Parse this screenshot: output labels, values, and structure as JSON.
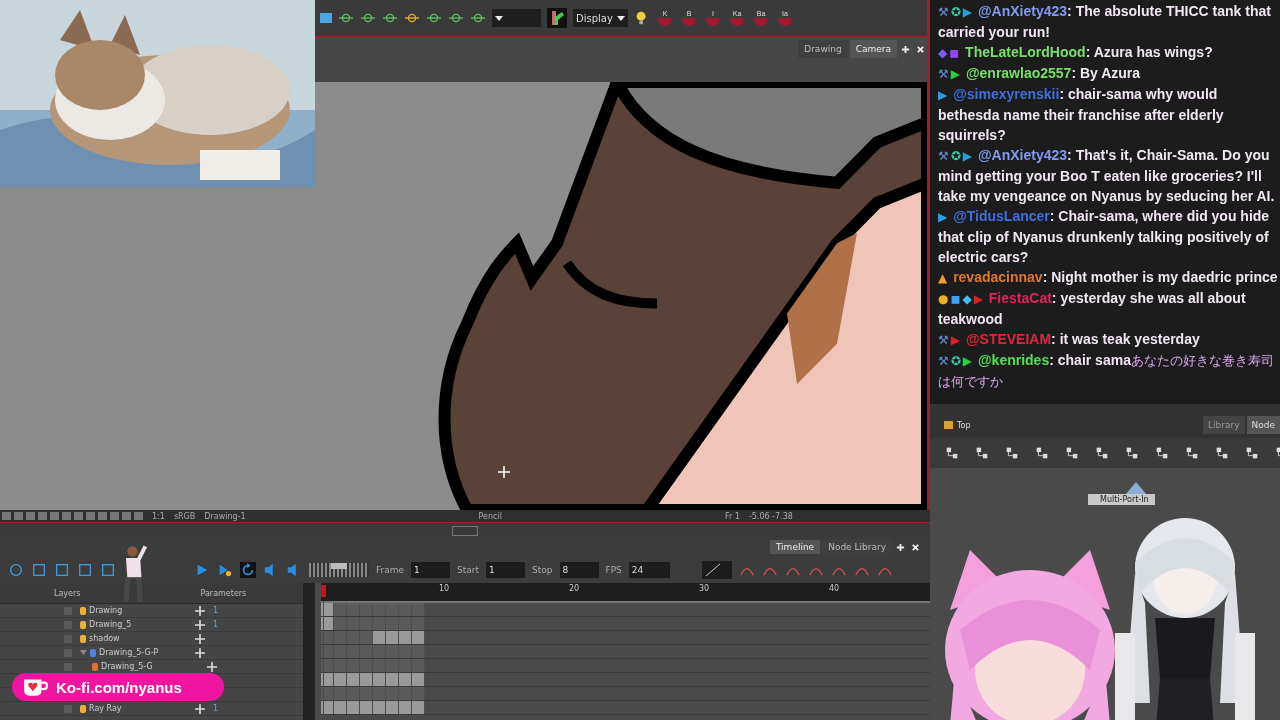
{
  "toolbar": {
    "display_select": "Display",
    "key_buttons": [
      "K",
      "B",
      "I",
      "Ka",
      "Ba",
      "Ia"
    ]
  },
  "view_tabs": [
    {
      "label": "Drawing",
      "selected": false
    },
    {
      "label": "Camera",
      "selected": true
    }
  ],
  "status_bar": {
    "zoom": "1:1",
    "color_space": "sRGB",
    "drawing": "Drawing-1",
    "tool": "Pencil",
    "frame": "Fr 1",
    "coordinates": "-5.06 -7.38"
  },
  "timeline_toolbar": {
    "frame_label": "Frame",
    "frame": "1",
    "start_label": "Start",
    "start": "1",
    "stop_label": "Stop",
    "stop": "8",
    "fps_label": "FPS",
    "fps": "24"
  },
  "playback_speed": {
    "level": 0.5
  },
  "timeline_tabs": [
    {
      "label": "Timeline",
      "selected": true
    },
    {
      "label": "Node Library",
      "selected": false
    }
  ],
  "layers_panel": {
    "layers_header": "Layers",
    "parameters_header": "Parameters",
    "layers": [
      {
        "name": "Drawing",
        "kind": "drawing",
        "param": "1",
        "frames": [
          true,
          false,
          false,
          false,
          false,
          false,
          false,
          false
        ]
      },
      {
        "name": "Drawing_5",
        "kind": "drawing",
        "param": "1",
        "frames": [
          true,
          false,
          false,
          false,
          false,
          false,
          false,
          false
        ]
      },
      {
        "name": "shadow",
        "kind": "drawing",
        "frames": [
          false,
          false,
          false,
          false,
          true,
          true,
          true,
          true
        ]
      },
      {
        "name": "Drawing_5-G-P",
        "kind": "group",
        "expanded": true,
        "frames": [
          false,
          false,
          false,
          false,
          false,
          false,
          false,
          false
        ],
        "children": [
          {
            "name": "Drawing_5-G",
            "kind": "composite",
            "frames": [
              false,
              false,
              false,
              false,
              false,
              false,
              false,
              false
            ]
          }
        ]
      },
      {
        "kind": "drawing",
        "frames": [
          true,
          true,
          true,
          true,
          true,
          true,
          true,
          true
        ]
      },
      {
        "kind": "drawing",
        "frames": [
          false,
          false,
          false,
          false,
          false,
          false,
          false,
          false
        ]
      },
      {
        "name": "Ray Ray",
        "kind": "drawing",
        "param": "1",
        "frames": [
          true,
          true,
          true,
          true,
          true,
          true,
          true,
          true
        ]
      }
    ]
  },
  "ruler": [
    "10",
    "20",
    "30",
    "40"
  ],
  "kofi_badge": "Ko-fi.com/nyanus",
  "chat": [
    {
      "badges": [
        {
          "glyph": "⚒",
          "color": "#5b8fd8"
        },
        {
          "glyph": "✪",
          "color": "#3fc8a8"
        },
        {
          "glyph": "▶",
          "color": "#2aa0e0"
        }
      ],
      "user": "@AnXiety423",
      "color": "#7f9cf0",
      "text": ": The absolute THICC tank that carried your run!"
    },
    {
      "badges": [
        {
          "glyph": "◆",
          "color": "#7a5cff"
        },
        {
          "glyph": "◼",
          "color": "#9146ff"
        }
      ],
      "user": "TheLateLordHood",
      "color": "#78e06a",
      "text": ": Azura has wings?"
    },
    {
      "badges": [
        {
          "glyph": "⚒",
          "color": "#5b8fd8"
        },
        {
          "glyph": "▶",
          "color": "#2ad040"
        }
      ],
      "user": "@enrawlao2557",
      "color": "#78e06a",
      "text": ": By Azura"
    },
    {
      "badges": [
        {
          "glyph": "▶",
          "color": "#2aa0e0"
        }
      ],
      "user": "@simexyrenskii",
      "color": "#3d6fe0",
      "text": ": chair-sama why would bethesda name their franchise after elderly squirrels?"
    },
    {
      "badges": [
        {
          "glyph": "⚒",
          "color": "#5b8fd8"
        },
        {
          "glyph": "✪",
          "color": "#3fc8a8"
        },
        {
          "glyph": "▶",
          "color": "#2aa0e0"
        }
      ],
      "user": "@AnXiety423",
      "color": "#7f9cf0",
      "text": ": That's it, Chair-Sama. Do you mind getting your Boo T eaten like groceries? I'll take my vengeance on Nyanus by seducing her AI."
    },
    {
      "badges": [
        {
          "glyph": "▶",
          "color": "#2aa0e0"
        }
      ],
      "user": "@TidusLancer",
      "color": "#3d6fe0",
      "text": ": Chair-sama, where did you hide that clip of Nyanus drunkenly talking positively of electric cars?"
    },
    {
      "badges": [
        {
          "glyph": "▲",
          "color": "#e8a030"
        }
      ],
      "user": "revadacinnav",
      "color": "#e0782a",
      "text": ": Night mother is my daedric prince"
    },
    {
      "badges": [
        {
          "glyph": "●",
          "color": "#f0b020"
        },
        {
          "glyph": "◼",
          "color": "#40a0f0"
        },
        {
          "glyph": "◆",
          "color": "#40c0f0"
        },
        {
          "glyph": "▶",
          "color": "#e02020"
        }
      ],
      "user": "FiestaCat",
      "color": "#e0245a",
      "text": ": yesterday she was all about teakwood"
    },
    {
      "badges": [
        {
          "glyph": "⚒",
          "color": "#5b8fd8"
        },
        {
          "glyph": "▶",
          "color": "#e02020"
        }
      ],
      "user": "@STEVEIAM",
      "color": "#e0243a",
      "text": ": it was teak yesterday"
    },
    {
      "badges": [
        {
          "glyph": "⚒",
          "color": "#5b8fd8"
        },
        {
          "glyph": "✪",
          "color": "#3fc8a8"
        },
        {
          "glyph": "▶",
          "color": "#2ad040"
        }
      ],
      "user": "@kenrides",
      "color": "#52e052",
      "text": ": chair sama",
      "foreign_text": "あなたの好きな巻き寿司は何ですか"
    }
  ],
  "node_view": {
    "breadcrumb": "Top",
    "tabs": [
      {
        "label": "Library",
        "selected": false
      },
      {
        "label": "Node",
        "selected": true
      }
    ],
    "node": "Multi-Port-In"
  }
}
